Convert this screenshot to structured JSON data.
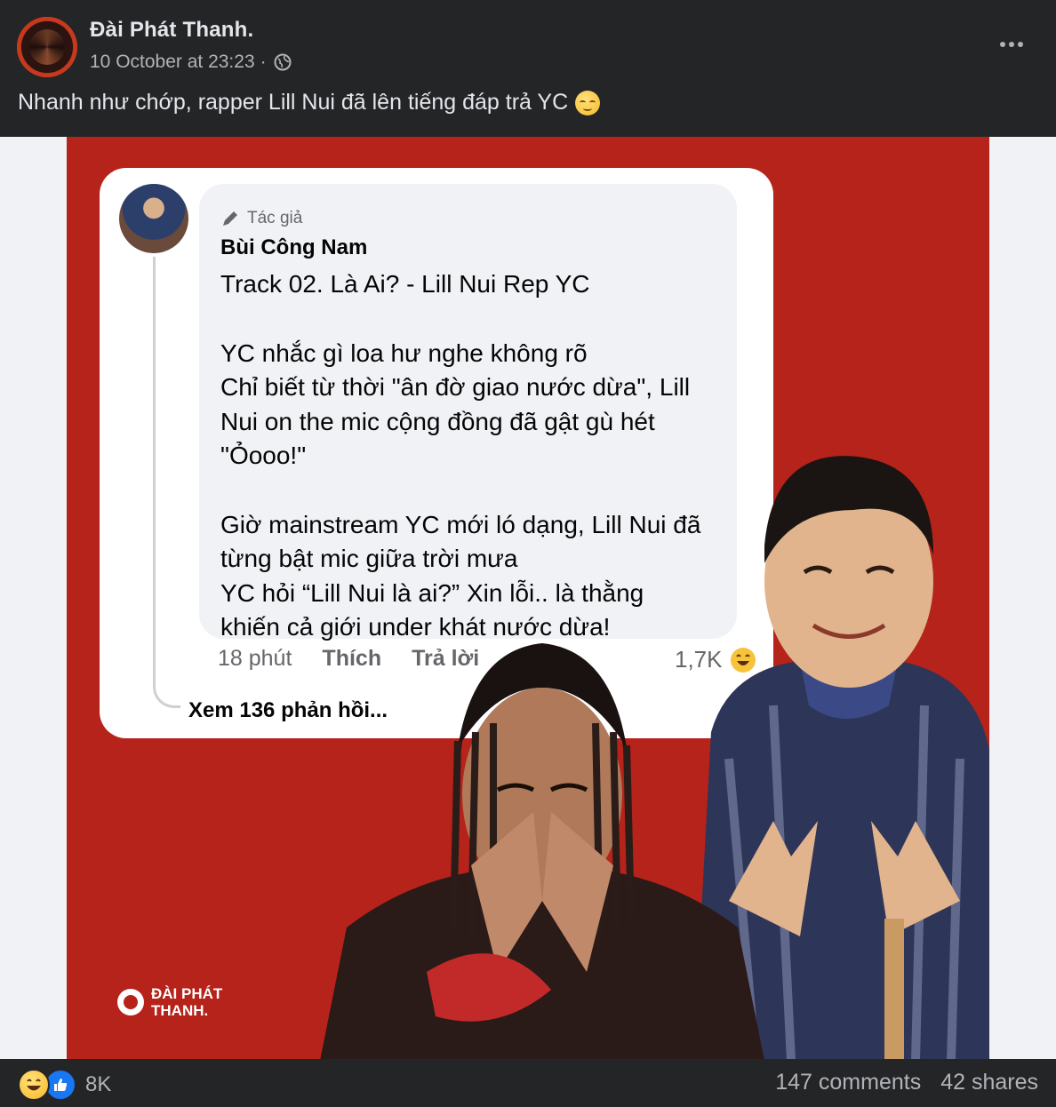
{
  "post": {
    "page_name": "Đài Phát Thanh.",
    "timestamp": "10 October at 23:23",
    "separator": "·",
    "privacy_icon": "globe-icon",
    "caption": "Nhanh như chớp, rapper Lill Nui đã lên tiếng đáp trả YC",
    "caption_emoji": "smiling-face-emoji",
    "more_icon": "more-dots-icon"
  },
  "poster": {
    "badge": "Tác giả",
    "author": "Bùi Công Nam",
    "lines": [
      "Track 02. Là Ai? - Lill Nui Rep YC",
      "YC nhắc gì loa hư nghe không rõ",
      "Chỉ biết từ thời \"ân đờ giao nước dừa\", Lill",
      "Nui on the mic cộng đồng đã gật gù hét",
      "\"Ỏooo!\"",
      "Giờ mainstream YC mới ló dạng, Lill Nui đã",
      "từng bật mic giữa trời mưa",
      "YC hỏi “Lill Nui là ai?” Xin lỗi.. là thằng",
      "khiến cả giới under khát nước dừa!"
    ],
    "time": "18 phút",
    "like": "Thích",
    "reply": "Trả lời",
    "reaction_count": "1,7K",
    "see_replies": "Xem 136 phản hồi...",
    "logo_line1": "ĐÀI PHÁT",
    "logo_line2": "THANH."
  },
  "footer": {
    "reaction_total": "8K",
    "comments": "147 comments",
    "shares": "42 shares"
  },
  "colors": {
    "poster_red": "#b5231a",
    "bg_dark": "#242526",
    "text_primary": "#e4e6eb",
    "text_secondary": "#b0b3b8",
    "like_blue": "#1877f2"
  }
}
